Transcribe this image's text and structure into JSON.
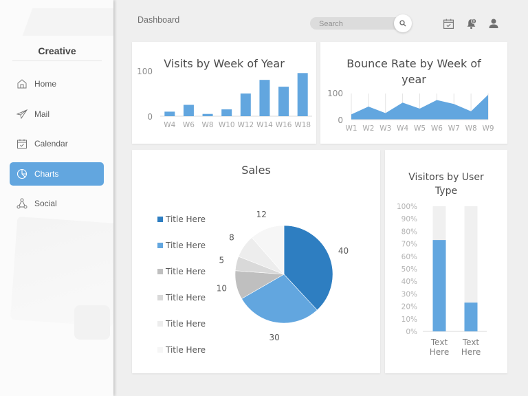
{
  "sidebar": {
    "brand": "Creative",
    "items": [
      {
        "label": "Home",
        "icon": "home-icon",
        "active": false
      },
      {
        "label": "Mail",
        "icon": "paper-plane-icon",
        "active": false
      },
      {
        "label": "Calendar",
        "icon": "calendar-check-icon",
        "active": false
      },
      {
        "label": "Charts",
        "icon": "pie-chart-icon",
        "active": true
      },
      {
        "label": "Social",
        "icon": "network-icon",
        "active": false
      }
    ]
  },
  "header": {
    "title": "Dashboard",
    "search_placeholder": "Search",
    "notification_count": "0",
    "icons": [
      "calendar-check-icon",
      "bell-icon",
      "user-icon"
    ]
  },
  "colors": {
    "accent": "#62a6df",
    "bar": "#62a6df",
    "pie": [
      "#2e7ec1",
      "#62a6df",
      "#bfbfbf",
      "#d9d9d9",
      "#ededed",
      "#f6f6f6"
    ],
    "track": "#f0f0f0"
  },
  "chart_data": [
    {
      "id": "visits",
      "type": "bar",
      "title": "Visits by Week of Year",
      "categories": [
        "W4",
        "W6",
        "W8",
        "W10",
        "W12",
        "W14",
        "W16",
        "W18"
      ],
      "values": [
        10,
        25,
        5,
        15,
        50,
        80,
        65,
        95
      ],
      "yticks": [
        "0",
        "100"
      ],
      "ylim": [
        0,
        100
      ],
      "xlabel": "",
      "ylabel": "",
      "grid": false
    },
    {
      "id": "bounce",
      "type": "area",
      "title": "Bounce Rate by Week of year",
      "categories": [
        "W1",
        "W2",
        "W3",
        "W4",
        "W5",
        "W6",
        "W7",
        "W8",
        "W9"
      ],
      "values": [
        20,
        50,
        25,
        65,
        42,
        75,
        60,
        32,
        95
      ],
      "yticks": [
        "0",
        "100"
      ],
      "ylim": [
        0,
        100
      ],
      "xlabel": "",
      "ylabel": "",
      "grid": "vertical"
    },
    {
      "id": "sales",
      "type": "pie",
      "title": "Sales",
      "labels": [
        "Title Here",
        "Title Here",
        "Title Here",
        "Title Here",
        "Title Here",
        "Title Here"
      ],
      "values": [
        40,
        30,
        10,
        5,
        8,
        12
      ],
      "legend": "left"
    },
    {
      "id": "visitors",
      "type": "bar",
      "stacked": "100%",
      "title": "Visitors by User Type",
      "categories": [
        "Text Here",
        "Text Here"
      ],
      "values": [
        73,
        23
      ],
      "yticks": [
        "0%",
        "10%",
        "20%",
        "30%",
        "40%",
        "50%",
        "60%",
        "70%",
        "80%",
        "90%",
        "100%"
      ],
      "ylim": [
        0,
        100
      ]
    }
  ]
}
